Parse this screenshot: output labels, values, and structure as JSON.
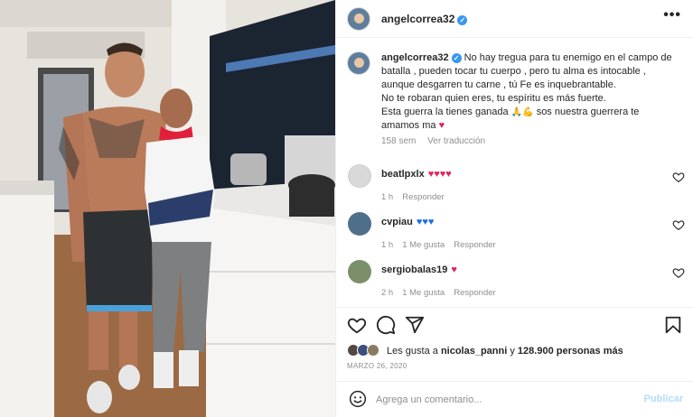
{
  "post": {
    "author": "angelcorrea32",
    "verified_icon": "verified-badge-icon",
    "more_icon": "more-options-icon"
  },
  "caption": {
    "user": "angelcorrea32",
    "line1": "No hay tregua para tu enemigo en el campo de batalla , pueden tocar tu cuerpo , pero tu alma es intocable , aunque desgarren tu carne , tú Fe es inquebrantable.",
    "line2": "No te robaran quien eres, tu espíritu es más fuerte.",
    "line3_before": "Esta guerra la tienes ganada",
    "line3_emoji": "🙏💪",
    "line3_after": "sos nuestra guerrera te amamos ma",
    "heart": "♥",
    "age": "158 sem",
    "translate": "Ver traducción"
  },
  "comments": [
    {
      "user": "beatlpxlx",
      "text": "♥♥♥♥",
      "age": "1 h",
      "likes": "",
      "reply": "Responder",
      "heart_color": "#e0245e",
      "avatar_color": "#d9d9d9"
    },
    {
      "user": "cvpiau",
      "text": "♥♥♥",
      "age": "1 h",
      "likes": "1 Me gusta",
      "reply": "Responder",
      "heart_color": "#1d6fd8",
      "avatar_color": "#4f6e8a"
    },
    {
      "user": "sergiobalas19",
      "text": "♥",
      "age": "2 h",
      "likes": "1 Me gusta",
      "reply": "Responder",
      "heart_color": "#e0245e",
      "avatar_color": "#7a8f6a"
    }
  ],
  "likes": {
    "prefix": "Les gusta a",
    "user": "nicolas_panni",
    "middle": "y",
    "count": "128.900 personas más"
  },
  "date": "MARZO 26, 2020",
  "add_comment": {
    "placeholder": "Agrega un comentario...",
    "publish": "Publicar"
  },
  "icons": {
    "like": "heart-icon",
    "comment": "comment-icon",
    "share": "share-icon",
    "save": "bookmark-icon",
    "emoji": "emoji-icon"
  }
}
